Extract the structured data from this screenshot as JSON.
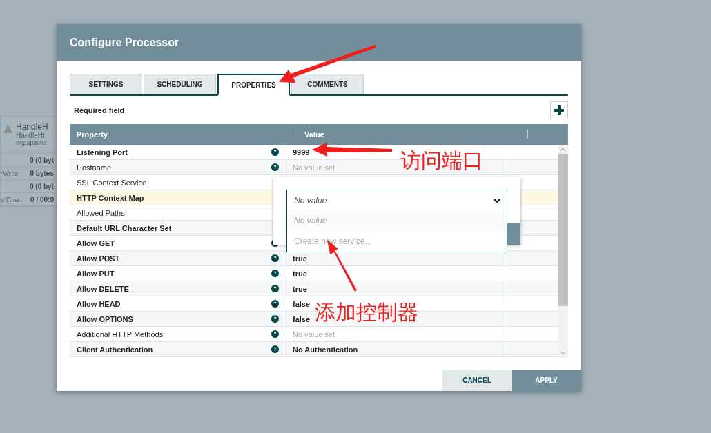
{
  "background_node": {
    "title": "HandleH",
    "type": "HandleHt",
    "bundle": "org.apache",
    "stats": [
      {
        "value": "0 (0 byt"
      },
      {
        "label": "/Write",
        "value": "0 bytes"
      },
      {
        "value": "0 (0 byt"
      },
      {
        "label": "s/Time",
        "value": "0 / 00:0"
      }
    ]
  },
  "dialog": {
    "title": "Configure Processor",
    "tabs": [
      {
        "label": "SETTINGS",
        "selected": false
      },
      {
        "label": "SCHEDULING",
        "selected": false
      },
      {
        "label": "PROPERTIES",
        "selected": true
      },
      {
        "label": "COMMENTS",
        "selected": false
      }
    ],
    "required_note": "Required field",
    "table": {
      "columns": [
        "Property",
        "Value"
      ],
      "rows": [
        {
          "name": "Listening Port",
          "required": true,
          "help": true,
          "value": "9999",
          "value_set": true,
          "highlighted": false
        },
        {
          "name": "Hostname",
          "required": false,
          "help": true,
          "value": "No value set",
          "value_set": false,
          "highlighted": false
        },
        {
          "name": "SSL Context Service",
          "required": false,
          "help": false,
          "highlighted": false
        },
        {
          "name": "HTTP Context Map",
          "required": true,
          "help": false,
          "highlighted": true
        },
        {
          "name": "Allowed Paths",
          "required": false,
          "help": false,
          "highlighted": false
        },
        {
          "name": "Default URL Character Set",
          "required": true,
          "help": false,
          "highlighted": false
        },
        {
          "name": "Allow GET",
          "required": true,
          "help": true,
          "highlighted": false
        },
        {
          "name": "Allow POST",
          "required": true,
          "help": true,
          "value": "true",
          "value_set": true,
          "highlighted": false
        },
        {
          "name": "Allow PUT",
          "required": true,
          "help": true,
          "value": "true",
          "value_set": true,
          "highlighted": false
        },
        {
          "name": "Allow DELETE",
          "required": true,
          "help": true,
          "value": "true",
          "value_set": true,
          "highlighted": false
        },
        {
          "name": "Allow HEAD",
          "required": true,
          "help": true,
          "value": "false",
          "value_set": true,
          "highlighted": false
        },
        {
          "name": "Allow OPTIONS",
          "required": true,
          "help": true,
          "value": "false",
          "value_set": true,
          "highlighted": false
        },
        {
          "name": "Additional HTTP Methods",
          "required": false,
          "help": true,
          "value": "No value set",
          "value_set": false,
          "highlighted": false
        },
        {
          "name": "Client Authentication",
          "required": true,
          "help": true,
          "value": "No Authentication",
          "value_set": true,
          "highlighted": false
        }
      ]
    },
    "dropdown": {
      "value": "No value",
      "options": [
        {
          "label": "No value",
          "kind": "empty"
        },
        {
          "label": "Create new service...",
          "kind": "action"
        }
      ]
    },
    "buttons": [
      {
        "label": "CANCEL",
        "kind": "secondary"
      },
      {
        "label": "APPLY",
        "kind": "primary"
      }
    ]
  },
  "annotations": [
    {
      "text": "访问端口"
    },
    {
      "text": "添加控制器"
    }
  ]
}
